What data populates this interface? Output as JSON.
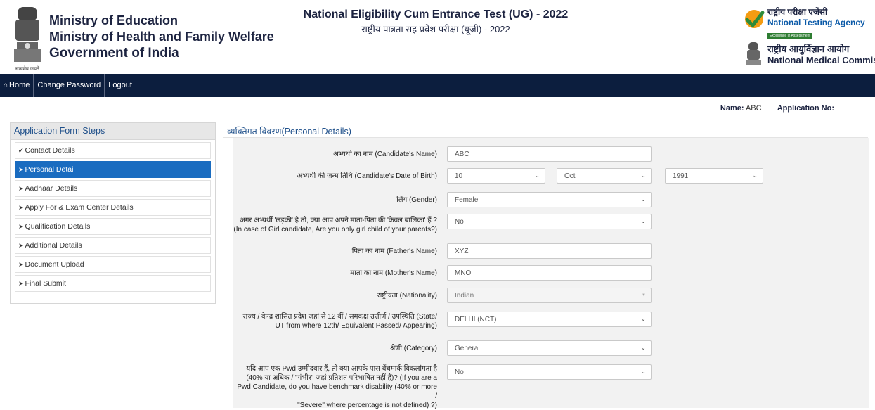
{
  "header": {
    "org_line1": "Ministry of Education",
    "org_line2": "Ministry of Health and Family Welfare",
    "org_line3": "Government of India",
    "emblem_motto": "सत्यमेव जयते",
    "exam_title_en": "National Eligibility Cum Entrance Test (UG) - 2022",
    "exam_title_hi": "राष्ट्रीय पात्रता सह प्रवेश परीक्षा (यूजी) - 2022",
    "nta_hi": "राष्ट्रीय परीक्षा एजेंसी",
    "nta_en": "National Testing Agency",
    "nta_tagline": "Excellence in Assessment",
    "nmc_hi": "राष्ट्रीय आयुर्विज्ञान आयोग",
    "nmc_en": "National Medical Commission"
  },
  "nav": {
    "home": "Home",
    "change_password": "Change Password",
    "logout": "Logout"
  },
  "user": {
    "name_label": "Name:",
    "name_value": "ABC",
    "appno_label": "Application No:",
    "appno_value": ""
  },
  "sidebar": {
    "title": "Application Form Steps",
    "steps": [
      {
        "label": "Contact Details",
        "icon": "check-circle-icon"
      },
      {
        "label": "Personal Detail",
        "icon": "arrow-circle-icon"
      },
      {
        "label": "Aadhaar Details",
        "icon": "arrow-circle-icon"
      },
      {
        "label": "Apply For & Exam Center Details",
        "icon": "arrow-circle-icon"
      },
      {
        "label": "Qualification Details",
        "icon": "arrow-circle-icon"
      },
      {
        "label": "Additional Details",
        "icon": "arrow-circle-icon"
      },
      {
        "label": "Document Upload",
        "icon": "arrow-circle-icon"
      },
      {
        "label": "Final Submit",
        "icon": "arrow-circle-icon"
      }
    ]
  },
  "section": {
    "title_hi": "व्यक्तिगत विवरण",
    "title_en": "(Personal Details)"
  },
  "form": {
    "name_label": "अभ्यर्थी का नाम (Candidate's Name)",
    "name_value": "ABC",
    "dob_label": "अभ्यर्थी की जन्म तिथि (Candidate's Date of Birth)",
    "dob_day": "10",
    "dob_month": "Oct",
    "dob_year": "1991",
    "gender_label": "लिंग (Gender)",
    "gender_value": "Female",
    "girl_child_label_1": "अगर अभ्यर्थी 'लड़की' है तो, क्या आप अपने माता-पिता की 'केवल बालिका' हैं ?",
    "girl_child_label_2": "(In case of Girl candidate, Are you only girl child of your parents?)",
    "girl_child_value": "No",
    "father_label": "पिता का नाम (Father's Name)",
    "father_value": "XYZ",
    "mother_label": "माता का नाम (Mother's Name)",
    "mother_value": "MNO",
    "nationality_label": "राष्ट्रीयता (Nationality)",
    "nationality_value": "Indian",
    "state_label_1": "राज्य / केन्द्र शासित प्रदेश जहां से 12 वीं / समकक्ष उत्तीर्ण / उपस्थिति (State/",
    "state_label_2": "UT from where 12th/ Equivalent Passed/ Appearing)",
    "state_value": "DELHI (NCT)",
    "category_label": "श्रेणी (Category)",
    "category_value": "General",
    "pwd_label_1": "यदि आप एक Pwd उम्मीदवार हैं, तो क्या आपके पास बेंचमार्क विकलांगता है",
    "pwd_label_2": "(40% या अधिक / \"गंभीर\" जहां प्रतिशत परिभाषित नहीं है)? (If you are a",
    "pwd_label_3": "Pwd Candidate, do you have benchmark disability (40% or more /",
    "pwd_label_4": "\"Severe\" where percentage is not defined) ?)",
    "pwd_value": "No"
  }
}
